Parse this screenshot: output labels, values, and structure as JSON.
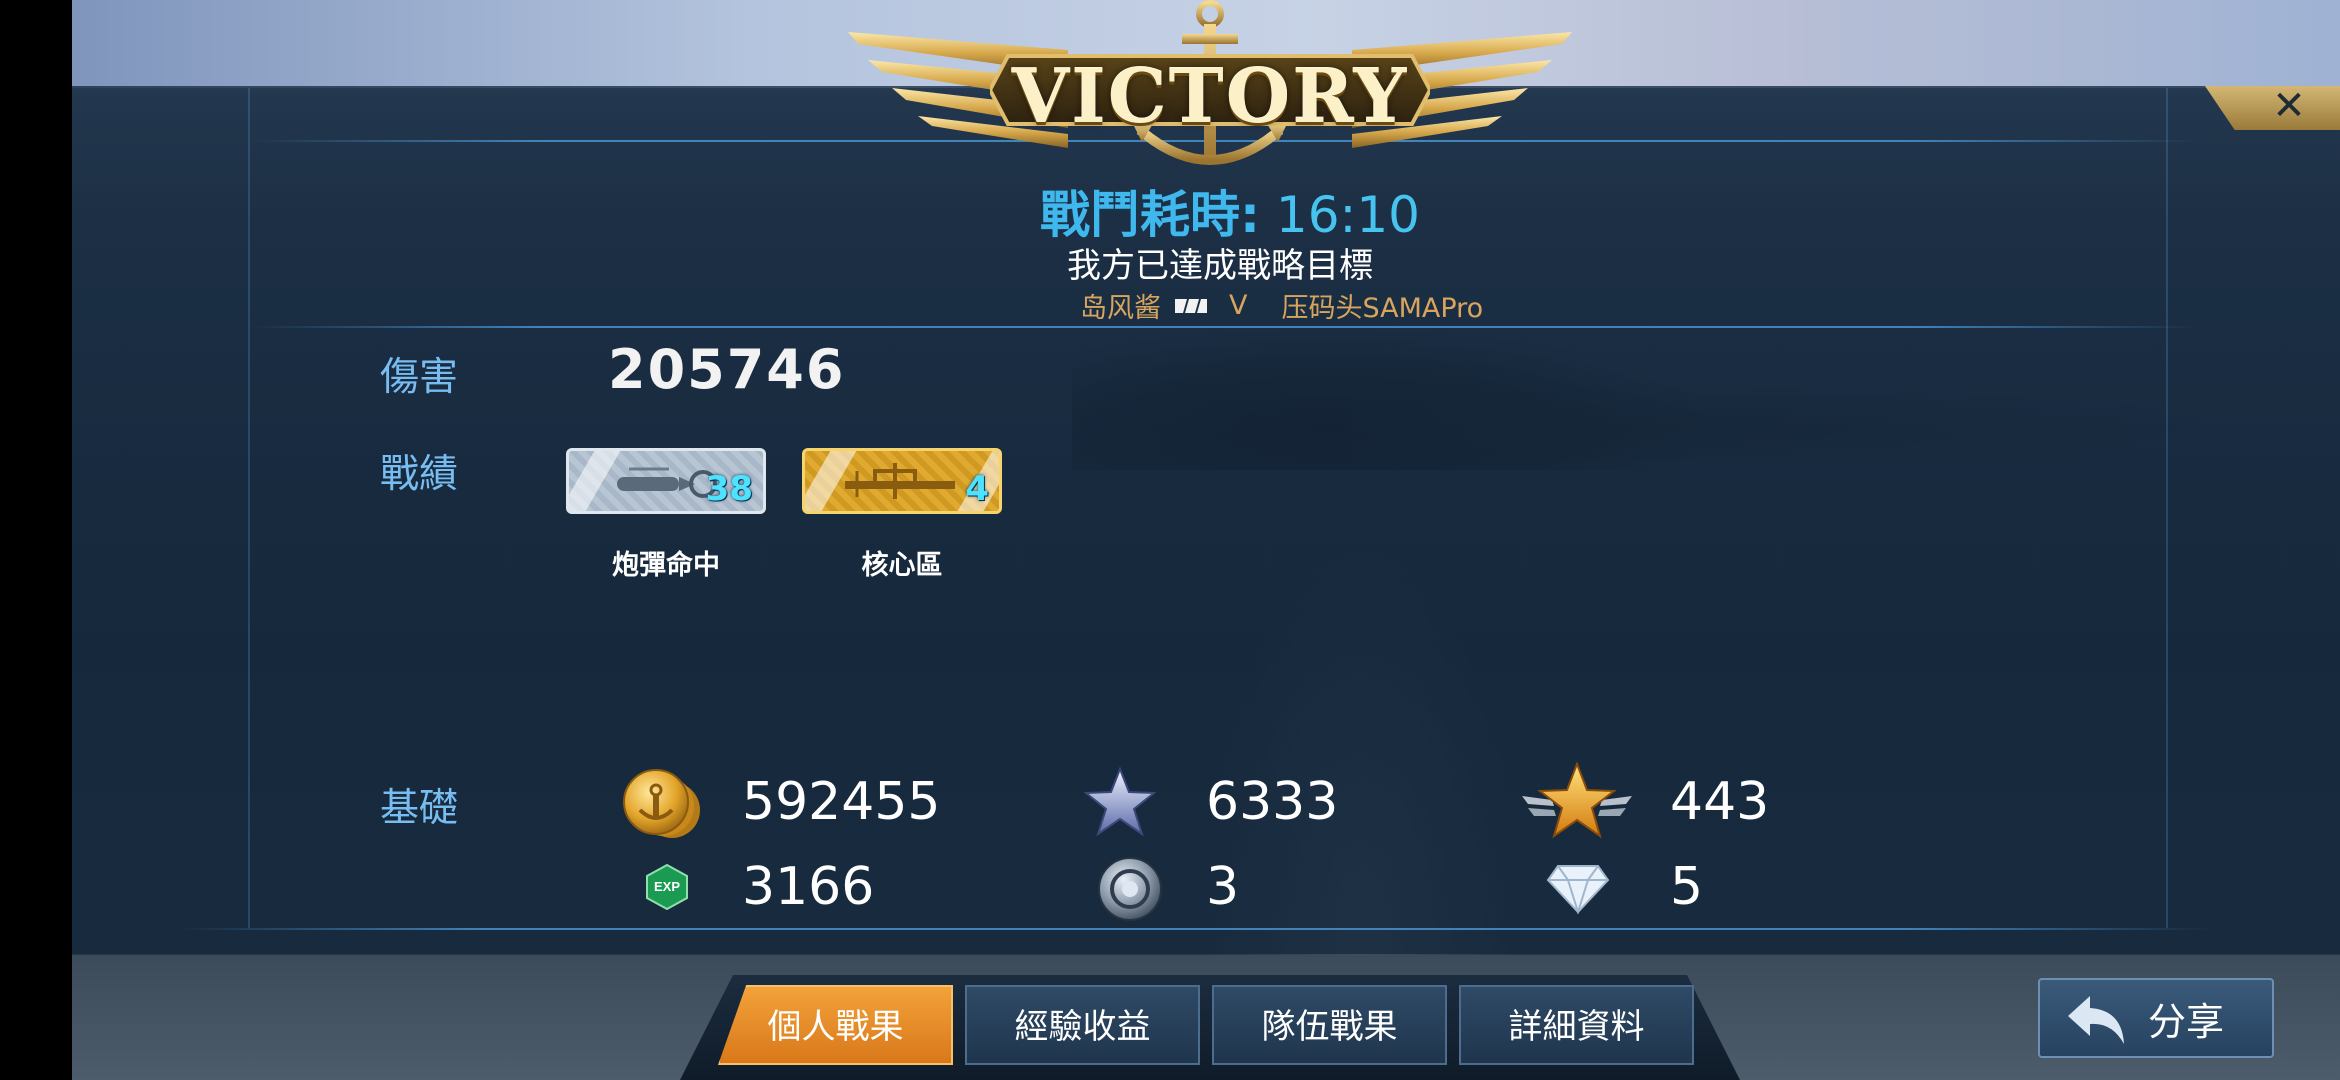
{
  "header": {
    "title": "VICTORY",
    "close_icon": "close-icon",
    "battle_time_label": "戰鬥耗時:",
    "battle_time_value": "16:10",
    "objective": "我方已達成戰略目標",
    "team_left": "岛风酱",
    "versus": "V",
    "team_right": "压码头SAMAPro"
  },
  "damage": {
    "label": "傷害",
    "value": "205746"
  },
  "achievements": {
    "label": "戰績",
    "medals": [
      {
        "name": "炮彈命中",
        "count": "38",
        "style": "silver",
        "icon": "shell-hit-icon"
      },
      {
        "name": "核心區",
        "count": "4",
        "style": "gold",
        "icon": "core-zone-icon"
      }
    ]
  },
  "basics": {
    "label": "基礎",
    "coins": "592455",
    "star_points": "6333",
    "gold_star": "443",
    "exp": "3166",
    "exp_badge": "EXP",
    "steel": "3",
    "diamonds": "5"
  },
  "tabs": [
    {
      "label": "個人戰果",
      "active": true
    },
    {
      "label": "經驗收益",
      "active": false
    },
    {
      "label": "隊伍戰果",
      "active": false
    },
    {
      "label": "詳細資料",
      "active": false
    }
  ],
  "share": {
    "label": "分享",
    "icon": "share-arrow-icon"
  },
  "colors": {
    "accent_blue": "#47c3f0",
    "label_blue": "#78bdf2",
    "gold": "#d9a55e",
    "tab_active": "#f3a23a"
  }
}
